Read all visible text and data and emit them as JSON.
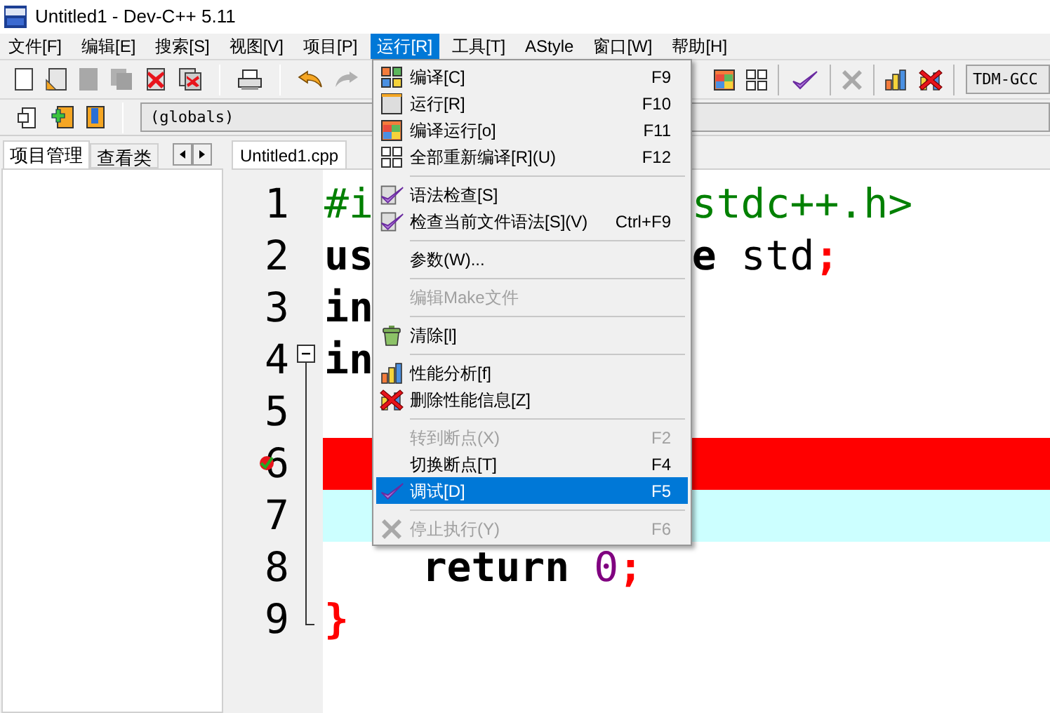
{
  "window": {
    "title": "Untitled1 - Dev-C++ 5.11"
  },
  "menubar": [
    {
      "label": "文件[F]",
      "selected": false
    },
    {
      "label": "编辑[E]",
      "selected": false
    },
    {
      "label": "搜索[S]",
      "selected": false
    },
    {
      "label": "视图[V]",
      "selected": false
    },
    {
      "label": "项目[P]",
      "selected": false
    },
    {
      "label": "运行[R]",
      "selected": true
    },
    {
      "label": "工具[T]",
      "selected": false
    },
    {
      "label": "AStyle",
      "selected": false
    },
    {
      "label": "窗口[W]",
      "selected": false
    },
    {
      "label": "帮助[H]",
      "selected": false
    }
  ],
  "toolbar": {
    "compiler": "TDM-GCC",
    "scope": "(globals)"
  },
  "side_tabs": [
    {
      "label": "项目管理",
      "selected": true
    },
    {
      "label": "查看类",
      "selected": false
    }
  ],
  "editor_tabs": [
    {
      "label": "Untitled1.cpp",
      "selected": true
    }
  ],
  "fold": {
    "expanded": true
  },
  "code_lines": [
    {
      "number": "1",
      "breakpoint": false,
      "current": false,
      "left": [
        {
          "text": "#i",
          "kind": "preprocessor"
        }
      ],
      "right": [
        {
          "text": "stdc++.h>",
          "kind": "preprocessor"
        }
      ]
    },
    {
      "number": "2",
      "breakpoint": false,
      "current": false,
      "left": [
        {
          "text": "us",
          "kind": "keyword"
        }
      ],
      "right": [
        {
          "text": "e",
          "kind": "keyword"
        },
        {
          "text": " std",
          "kind": "plain"
        },
        {
          "text": ";",
          "kind": "symbol"
        }
      ]
    },
    {
      "number": "3",
      "breakpoint": false,
      "current": false,
      "left": [
        {
          "text": "in",
          "kind": "keyword"
        }
      ]
    },
    {
      "number": "4",
      "breakpoint": false,
      "current": false,
      "left": [
        {
          "text": "in",
          "kind": "keyword"
        }
      ]
    },
    {
      "number": "5",
      "breakpoint": false,
      "current": false
    },
    {
      "number": "6",
      "breakpoint": true,
      "current": false
    },
    {
      "number": "7",
      "breakpoint": false,
      "current": true
    },
    {
      "number": "8",
      "breakpoint": false,
      "current": false,
      "left": [
        {
          "text": "    return ",
          "kind": "keyword"
        },
        {
          "text": "0",
          "kind": "number"
        },
        {
          "text": ";",
          "kind": "symbol"
        }
      ]
    },
    {
      "number": "9",
      "breakpoint": false,
      "current": false,
      "left": [
        {
          "text": "}",
          "kind": "symbol"
        }
      ]
    }
  ],
  "run_menu": [
    {
      "kind": "item",
      "label": "编译[C]",
      "shortcut": "F9",
      "disabled": false,
      "selected": false
    },
    {
      "kind": "item",
      "label": "运行[R]",
      "shortcut": "F10",
      "disabled": false,
      "selected": false
    },
    {
      "kind": "item",
      "label": "编译运行[o]",
      "shortcut": "F11",
      "disabled": false,
      "selected": false
    },
    {
      "kind": "item",
      "label": "全部重新编译[R](U)",
      "shortcut": "F12",
      "disabled": false,
      "selected": false
    },
    {
      "kind": "separator"
    },
    {
      "kind": "item",
      "label": "语法检查[S]",
      "disabled": false,
      "selected": false
    },
    {
      "kind": "item",
      "label": "检查当前文件语法[S](V)",
      "shortcut": "Ctrl+F9",
      "disabled": false,
      "selected": false
    },
    {
      "kind": "separator"
    },
    {
      "kind": "item",
      "label": "参数(W)...",
      "disabled": false,
      "selected": false
    },
    {
      "kind": "separator"
    },
    {
      "kind": "item",
      "label": "编辑Make文件",
      "disabled": true,
      "selected": false
    },
    {
      "kind": "separator"
    },
    {
      "kind": "item",
      "label": "清除[l]",
      "disabled": false,
      "selected": false
    },
    {
      "kind": "separator"
    },
    {
      "kind": "item",
      "label": "性能分析[f]",
      "disabled": false,
      "selected": false
    },
    {
      "kind": "item",
      "label": "删除性能信息[Z]",
      "disabled": false,
      "selected": false
    },
    {
      "kind": "separator"
    },
    {
      "kind": "item",
      "label": "转到断点(X)",
      "shortcut": "F2",
      "disabled": true,
      "selected": false
    },
    {
      "kind": "item",
      "label": "切换断点[T]",
      "shortcut": "F4",
      "disabled": false,
      "selected": false
    },
    {
      "kind": "item",
      "label": "调试[D]",
      "shortcut": "F5",
      "disabled": false,
      "selected": true
    },
    {
      "kind": "separator"
    },
    {
      "kind": "item",
      "label": "停止执行(Y)",
      "shortcut": "F6",
      "disabled": true,
      "selected": false
    }
  ]
}
